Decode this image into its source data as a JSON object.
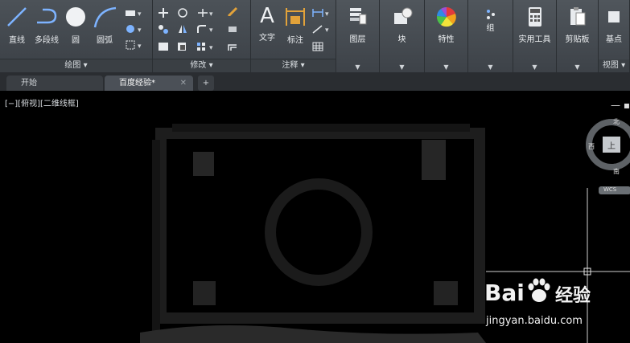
{
  "ribbon": {
    "draw_tools": {
      "line": "直线",
      "polyline": "多段线",
      "circle": "圆",
      "arc": "圆弧"
    },
    "draw_group": "绘图 ▾",
    "modify_group": "修改 ▾",
    "annotate": {
      "text": "文字",
      "dimension": "标注",
      "group": "注释 ▾"
    },
    "panels": {
      "layers": "图层",
      "block": "块",
      "properties": "特性",
      "groups": "组",
      "utilities": "实用工具",
      "clipboard": "剪贴板",
      "basepoint": "基点",
      "view": "视图 ▾"
    },
    "panel_arrow": "▼"
  },
  "tabs": {
    "start": "开始",
    "doc": "百度经验*",
    "close": "✕",
    "add": "+"
  },
  "viewport": {
    "label": "[−][俯视][二维线框]",
    "viewcube": {
      "north": "北",
      "south": "南",
      "west": "西",
      "top": "上",
      "wcs": "WCS"
    }
  },
  "watermark": {
    "brand": "Bai",
    "brand2": "经验",
    "url": "jingyan.baidu.com"
  }
}
